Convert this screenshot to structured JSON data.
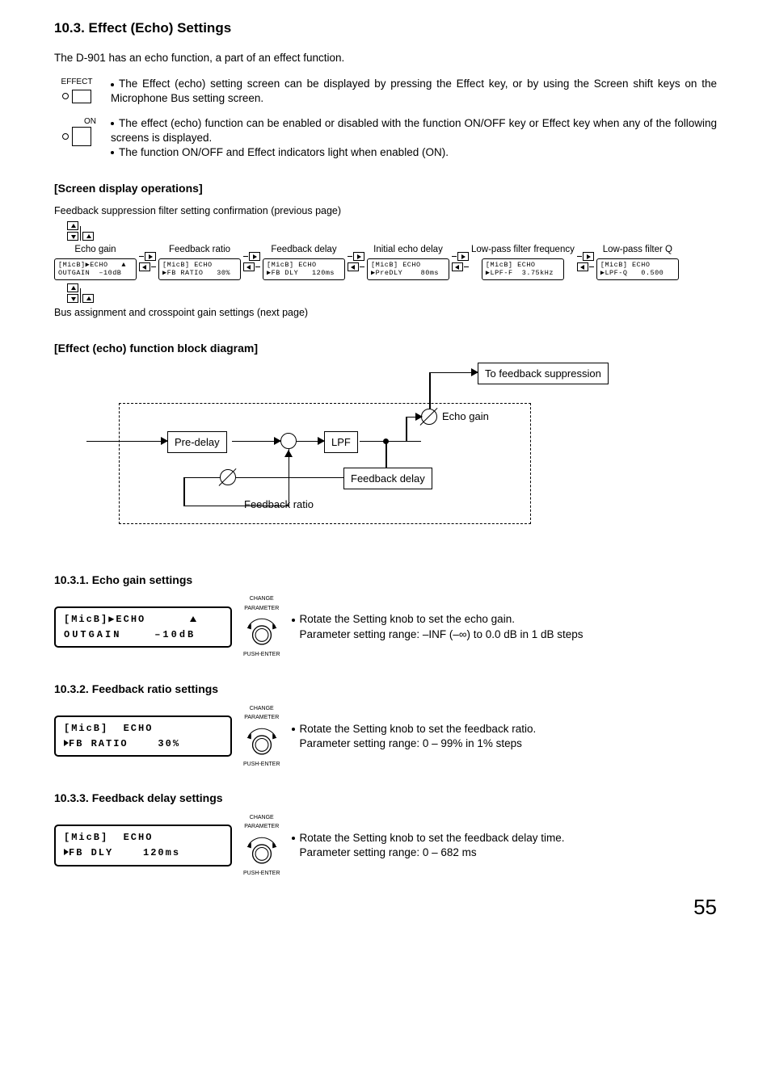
{
  "heading": "10.3. Effect (Echo) Settings",
  "intro": "The D-901 has an echo function, a part of an effect function.",
  "icon1": {
    "label": "EFFECT",
    "text": "The Effect (echo) setting screen can be displayed by pressing the Effect key, or by using the Screen shift keys on the Microphone Bus setting screen."
  },
  "icon2": {
    "label": "ON",
    "text1": "The effect (echo) function can be enabled or disabled with the function ON/OFF key or Effect key when any of the following screens is displayed.",
    "text2": "The function ON/OFF and Effect indicators light when enabled (ON)."
  },
  "sect_screen": "[Screen display operations]",
  "prev_caption": "Feedback suppression filter setting confirmation (previous page)",
  "next_caption": "Bus assignment and crosspoint gain settings (next page)",
  "screens": [
    {
      "label": "Echo gain",
      "l1": "[MicB]▶ECHO   ▲",
      "l2": "OUTGAIN  –10dB"
    },
    {
      "label": "Feedback ratio",
      "l1": "[MicB] ECHO",
      "l2": "▶FB RATIO   30%"
    },
    {
      "label": "Feedback delay",
      "l1": "[MicB] ECHO",
      "l2": "▶FB DLY   120ms"
    },
    {
      "label": "Initial echo delay",
      "l1": "[MicB] ECHO",
      "l2": "▶PreDLY    80ms"
    },
    {
      "label": "Low-pass filter frequency",
      "l1": "[MicB] ECHO",
      "l2": "▶LPF-F  3.75kHz"
    },
    {
      "label": "Low-pass filter Q",
      "l1": "[MicB] ECHO",
      "l2": "▶LPF-Q   0.500"
    }
  ],
  "sect_block": "[Effect (echo) function block diagram]",
  "block": {
    "pre": "Pre-delay",
    "lpf": "LPF",
    "gain": "Echo gain",
    "fbdelay": "Feedback delay",
    "fbratio": "Feedback ratio",
    "tofb": "To feedback suppression"
  },
  "knob": {
    "top": "CHANGE",
    "mid": "PARAMETER",
    "bot": "PUSH-ENTER"
  },
  "s1": {
    "h": "10.3.1. Echo gain settings",
    "lcd1": "[MicB]▶ECHO      ",
    "lcd1_tri": true,
    "lcd2": "OUTGAIN    –10dB",
    "p1": "Rotate the Setting knob to set the echo gain.",
    "p2": "Parameter setting range: –INF (–∞) to 0.0 dB in 1 dB steps"
  },
  "s2": {
    "h": "10.3.2. Feedback ratio settings",
    "lcd1": "[MicB]  ECHO",
    "lcd2": "▶FB RATIO    30%",
    "p1": "Rotate the Setting knob to set the feedback ratio.",
    "p2": "Parameter setting range: 0 – 99% in 1% steps"
  },
  "s3": {
    "h": "10.3.3. Feedback delay settings",
    "lcd1": "[MicB]  ECHO",
    "lcd2": "▶FB DLY    120ms",
    "p1": "Rotate the Setting knob to set the feedback delay time.",
    "p2": "Parameter setting range: 0 – 682 ms"
  },
  "page": "55"
}
